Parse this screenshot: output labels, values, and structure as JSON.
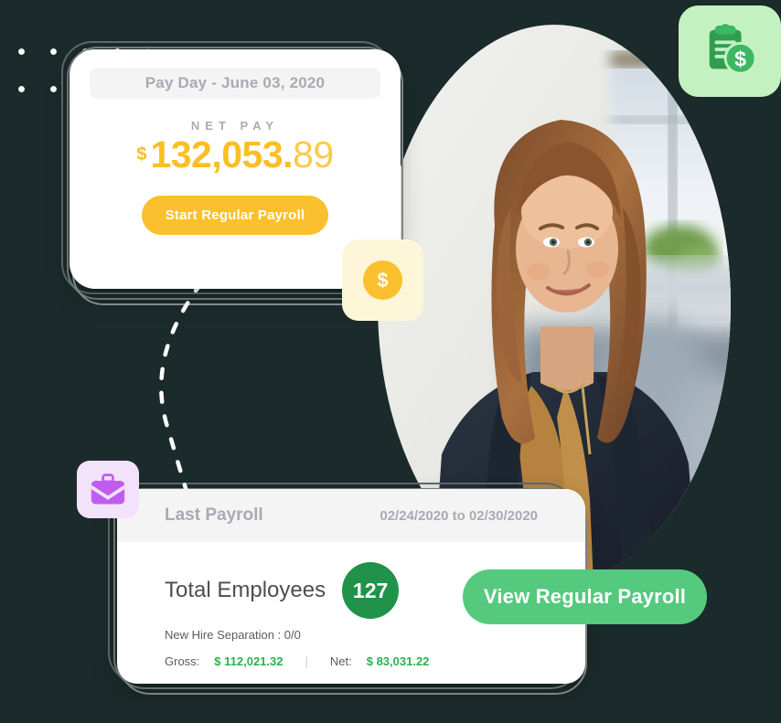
{
  "theme": {
    "background": "#1b2a2a",
    "yellow": "#fbc02d",
    "green": "#21924a",
    "green_button": "#55c97e",
    "green_money": "#2bb04f",
    "muted_text": "#a8abb2",
    "badge_green_bg": "#c3f2c0",
    "badge_yellow_bg": "#fdf6d8",
    "badge_purple_bg": "#f3e2fb",
    "purple_icon": "#c05cf0"
  },
  "pay_card": {
    "header": "Pay Day - June 03, 2020",
    "net_pay_label": "NET PAY",
    "currency_symbol": "$",
    "amount_whole": "132,053.",
    "amount_decimals": "89",
    "amount_full": "$ 132,053.89",
    "primary_button": "Start Regular Payroll"
  },
  "last_payroll_card": {
    "title": "Last Payroll",
    "date_range": "02/24/2020 to 02/30/2020",
    "total_employees_label": "Total Employees",
    "total_employees_count": "127",
    "new_hire_separation": "New Hire Separation : 0/0",
    "gross_label": "Gross:",
    "gross_value": "$ 112,021.32",
    "separator": "|",
    "net_label": "Net:",
    "net_value": "$ 83,031.22"
  },
  "cta": {
    "view_payroll_button": "View Regular Payroll"
  },
  "badges": {
    "clipboard_icon": "clipboard-money-icon",
    "dollar_icon": "dollar-coin-icon",
    "dollar_glyph": "$",
    "briefcase_icon": "briefcase-icon"
  },
  "decor": {
    "dot_grid": "dot-grid-pattern",
    "dashed_connector": "dashed-curve-connector",
    "photo": "woman-office-portrait"
  }
}
